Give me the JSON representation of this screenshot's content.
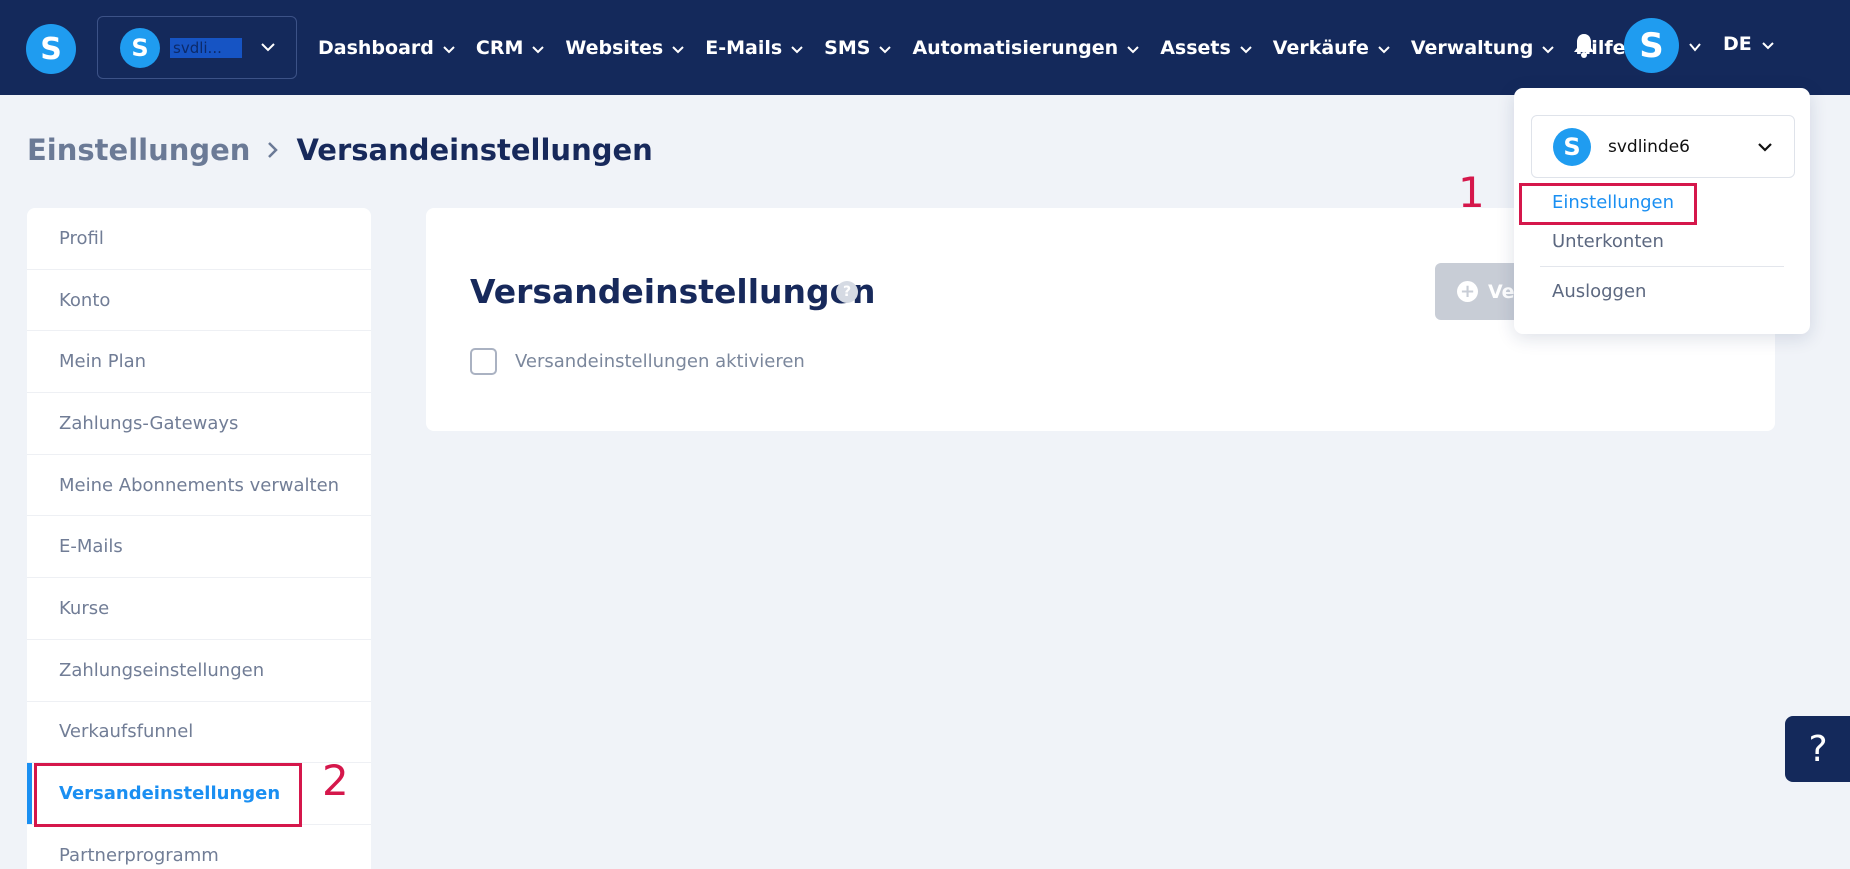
{
  "header": {
    "logo_letter": "S",
    "workspace": {
      "avatar_letter": "S",
      "name": "svdli..."
    },
    "nav": [
      {
        "label": "Dashboard",
        "has_chevron": true
      },
      {
        "label": "CRM",
        "has_chevron": true
      },
      {
        "label": "Websites",
        "has_chevron": true
      },
      {
        "label": "E-Mails",
        "has_chevron": true
      },
      {
        "label": "SMS",
        "has_chevron": true
      },
      {
        "label": "Automatisierungen",
        "has_chevron": true
      },
      {
        "label": "Assets",
        "has_chevron": true
      },
      {
        "label": "Verkäufe",
        "has_chevron": true
      },
      {
        "label": "Verwaltung",
        "has_chevron": true
      },
      {
        "label": "Hilfe",
        "has_chevron": false
      }
    ],
    "user_avatar_letter": "S",
    "language": "DE"
  },
  "breadcrumb": {
    "parent": "Einstellungen",
    "current": "Versandeinstellungen"
  },
  "sidebar": {
    "items": [
      {
        "label": "Profil",
        "active": false
      },
      {
        "label": "Konto",
        "active": false
      },
      {
        "label": "Mein Plan",
        "active": false
      },
      {
        "label": "Zahlungs-Gateways",
        "active": false
      },
      {
        "label": "Meine Abonnements verwalten",
        "active": false
      },
      {
        "label": "E-Mails",
        "active": false
      },
      {
        "label": "Kurse",
        "active": false
      },
      {
        "label": "Zahlungseinstellungen",
        "active": false
      },
      {
        "label": "Verkaufsfunnel",
        "active": false
      },
      {
        "label": "Versandeinstellungen",
        "active": true
      },
      {
        "label": "Partnerprogramm",
        "active": false
      }
    ]
  },
  "main": {
    "title": "Versandeinstellungen",
    "help_glyph": "?",
    "add_button_label": "Ve",
    "checkbox_label": "Versandeinstellungen aktivieren",
    "checkbox_checked": false
  },
  "dropdown": {
    "account_avatar_letter": "S",
    "account_name": "svdlinde6",
    "items": [
      {
        "label": "Einstellungen",
        "active": true
      },
      {
        "label": "Unterkonten",
        "active": false
      },
      {
        "label": "Ausloggen",
        "active": false
      }
    ]
  },
  "annotations": {
    "step1": "1",
    "step2": "2"
  },
  "floating_help_glyph": "?",
  "colors": {
    "nav_bg": "#14295b",
    "accent": "#1a8ff2",
    "logo_blue": "#1f9cf0",
    "annotation_red": "#d5174b",
    "page_bg": "#f0f3f8"
  }
}
